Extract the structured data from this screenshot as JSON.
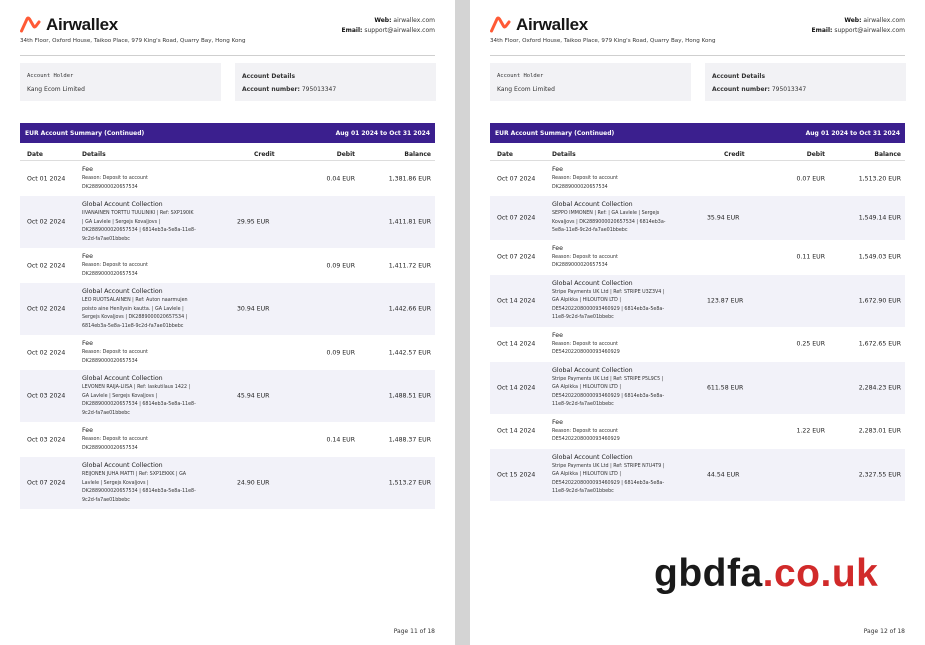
{
  "pages": [
    {
      "header": {
        "brand": "Airwallex",
        "address": "34th Floor, Oxford House, Taikoo Place, 979 King's Road, Quarry Bay, Hong Kong",
        "web_label": "Web:",
        "web_value": "airwallex.com",
        "email_label": "Email:",
        "email_value": "support@airwallex.com"
      },
      "account_holder_label": "Account Holder",
      "account_holder_value": "Kang Ecom Limited",
      "account_details_label": "Account Details",
      "account_number_label": "Account number:",
      "account_number_value": "795013347",
      "summary_title": "EUR Account Summary (Continued)",
      "summary_period": "Aug 01 2024 to Oct 31 2024",
      "columns": [
        "Date",
        "Details",
        "Credit",
        "Debit",
        "Balance"
      ],
      "rows": [
        {
          "date": "Oct 01 2024",
          "title": "Fee",
          "lines": [
            "Reason: Deposit to account",
            "DK2889000020657534"
          ],
          "credit": "",
          "debit": "0.04 EUR",
          "balance": "1,381.86 EUR"
        },
        {
          "date": "Oct 02 2024",
          "title": "Global Account Collection",
          "lines": [
            "IIVANAINEN TORTTU TUULINIKI | Ref: SXP190IK",
            "| GA Lavlele | Sergejs Kovaļjovs |",
            "DK2889000020657534 | 6814eb3a-5e8a-11e8-",
            "9c2d-fa7ae01bbebc"
          ],
          "credit": "29.95 EUR",
          "debit": "",
          "balance": "1,411.81 EUR"
        },
        {
          "date": "Oct 02 2024",
          "title": "Fee",
          "lines": [
            "Reason: Deposit to account",
            "DK2889000020657534"
          ],
          "credit": "",
          "debit": "0.09 EUR",
          "balance": "1,411.72 EUR"
        },
        {
          "date": "Oct 02 2024",
          "title": "Global Account Collection",
          "lines": [
            "LEO RUOTSALAINEN | Ref: Auton naarmujen",
            "poisto aine Henllysin kautta. | GA Lavlele |",
            "Sergejs Kovaļjovs | DK2889000020657534 |",
            "6814eb3a-5e8a-11e8-9c2d-fa7ae01bbebc"
          ],
          "credit": "30.94 EUR",
          "debit": "",
          "balance": "1,442.66 EUR"
        },
        {
          "date": "Oct 02 2024",
          "title": "Fee",
          "lines": [
            "Reason: Deposit to account",
            "DK2889000020657534"
          ],
          "credit": "",
          "debit": "0.09 EUR",
          "balance": "1,442.57 EUR"
        },
        {
          "date": "Oct 03 2024",
          "title": "Global Account Collection",
          "lines": [
            "LEVONEN RAIJA-LIISA | Ref: laskutilaus 1422 |",
            "GA Lavlele | Sergejs Kovaļjovs |",
            "DK2889000020657534 | 6814eb3a-5e8a-11e8-",
            "9c2d-fa7ae01bbebc"
          ],
          "credit": "45.94 EUR",
          "debit": "",
          "balance": "1,488.51 EUR"
        },
        {
          "date": "Oct 03 2024",
          "title": "Fee",
          "lines": [
            "Reason: Deposit to account",
            "DK2889000020657534"
          ],
          "credit": "",
          "debit": "0.14 EUR",
          "balance": "1,488.37 EUR"
        },
        {
          "date": "Oct 07 2024",
          "title": "Global Account Collection",
          "lines": [
            "REIJONEN JUHA MATTI | Ref: SXP1EKKK | GA",
            "Lavlele | Sergejs Kovaļjovs |",
            "DK2889000020657534 | 6814eb3a-5e8a-11e8-",
            "9c2d-fa7ae01bbebc"
          ],
          "credit": "24.90 EUR",
          "debit": "",
          "balance": "1,513.27 EUR"
        }
      ],
      "footer": "Page 11 of 18"
    },
    {
      "header": {
        "brand": "Airwallex",
        "address": "34th Floor, Oxford House, Taikoo Place, 979 King's Road, Quarry Bay, Hong Kong",
        "web_label": "Web:",
        "web_value": "airwallex.com",
        "email_label": "Email:",
        "email_value": "support@airwallex.com"
      },
      "account_holder_label": "Account Holder",
      "account_holder_value": "Kang Ecom Limited",
      "account_details_label": "Account Details",
      "account_number_label": "Account number:",
      "account_number_value": "795013347",
      "summary_title": "EUR Account Summary (Continued)",
      "summary_period": "Aug 01 2024 to Oct 31 2024",
      "columns": [
        "Date",
        "Details",
        "Credit",
        "Debit",
        "Balance"
      ],
      "rows": [
        {
          "date": "Oct 07 2024",
          "title": "Fee",
          "lines": [
            "Reason: Deposit to account",
            "DK2889000020657534"
          ],
          "credit": "",
          "debit": "0.07 EUR",
          "balance": "1,513.20 EUR"
        },
        {
          "date": "Oct 07 2024",
          "title": "Global Account Collection",
          "lines": [
            "SEPPO IMMONEN | Ref: | GA Lavlele | Sergejs",
            "Kovaļjovs | DK2889000020657534 | 6814eb3a-",
            "5e8a-11e8-9c2d-fa7ae01bbebc"
          ],
          "credit": "35.94 EUR",
          "debit": "",
          "balance": "1,549.14 EUR"
        },
        {
          "date": "Oct 07 2024",
          "title": "Fee",
          "lines": [
            "Reason: Deposit to account",
            "DK2889000020657534"
          ],
          "credit": "",
          "debit": "0.11 EUR",
          "balance": "1,549.03 EUR"
        },
        {
          "date": "Oct 14 2024",
          "title": "Global Account Collection",
          "lines": [
            "Stripe Payments UK Ltd | Ref: STRIPE U3Z3V4 |",
            "GA Alpikka | HILOUTON LTD |",
            "DE54202208000093460929 | 6814eb3a-5e8a-",
            "11e8-9c2d-fa7ae01bbebc"
          ],
          "credit": "123.87 EUR",
          "debit": "",
          "balance": "1,672.90 EUR"
        },
        {
          "date": "Oct 14 2024",
          "title": "Fee",
          "lines": [
            "Reason: Deposit to account",
            "DE54202208000093460929"
          ],
          "credit": "",
          "debit": "0.25 EUR",
          "balance": "1,672.65 EUR"
        },
        {
          "date": "Oct 14 2024",
          "title": "Global Account Collection",
          "lines": [
            "Stripe Payments UK Ltd | Ref: STRIPE P5L9C5 |",
            "GA Alpikka | HILOUTON LTD |",
            "DE54202208000093460929 | 6814eb3a-5e8a-",
            "11e8-9c2d-fa7ae01bbebc"
          ],
          "credit": "611.58 EUR",
          "debit": "",
          "balance": "2,284.23 EUR"
        },
        {
          "date": "Oct 14 2024",
          "title": "Fee",
          "lines": [
            "Reason: Deposit to account",
            "DE54202208000093460929"
          ],
          "credit": "",
          "debit": "1.22 EUR",
          "balance": "2,283.01 EUR"
        },
        {
          "date": "Oct 15 2024",
          "title": "Global Account Collection",
          "lines": [
            "Stripe Payments UK Ltd | Ref: STRIPE N7U4T9 |",
            "GA Alpikka | HILOUTON LTD |",
            "DE54202208000093460929 | 6814eb3a-5e8a-",
            "11e8-9c2d-fa7ae01bbebc"
          ],
          "credit": "44.54 EUR",
          "debit": "",
          "balance": "2,327.55 EUR"
        }
      ],
      "footer": "Page 12 of 18"
    }
  ],
  "watermark": {
    "part1": "gbdfa",
    "part2": ".co.uk"
  },
  "colors": {
    "summary_bar": "#3b1f8e",
    "row_shade": "#f2f2f9",
    "logo_orange": "#ff5a36",
    "watermark_red": "#d12a2a"
  }
}
